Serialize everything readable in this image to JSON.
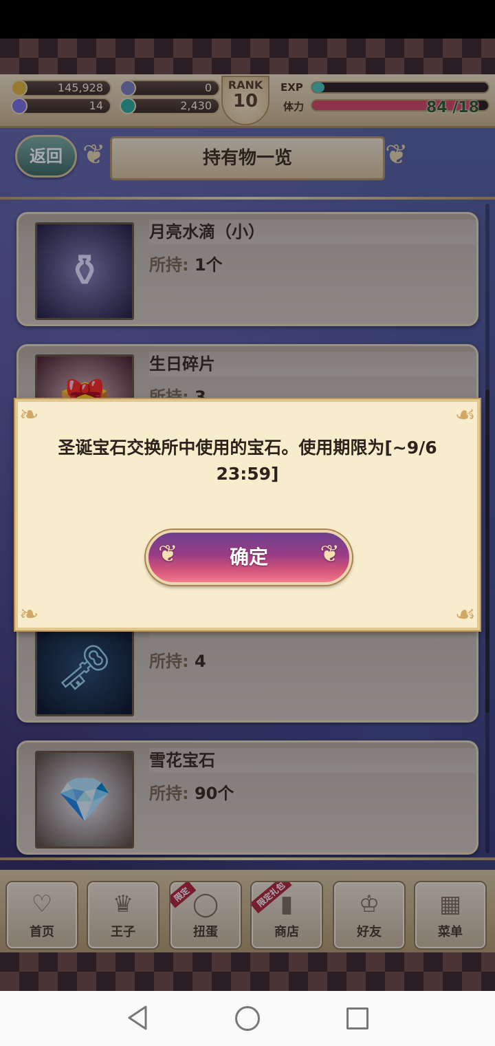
{
  "resources": {
    "gold": "145,928",
    "feather": "0",
    "crystal": "14",
    "gem": "2,430",
    "rank_label": "RANK",
    "rank_value": "10",
    "exp_label": "EXP",
    "exp_fraction": 0.07,
    "stamina_label": "体力",
    "stamina_text": "84 /18",
    "stamina_fraction": 0.95,
    "colors": {
      "gold": "#e2b93a",
      "feather": "#7f7fb8",
      "crystal": "#7c6fe0",
      "gem": "#2fae9b",
      "exp": "#4cc7b8",
      "stamina": "#d64b63"
    }
  },
  "header": {
    "back_label": "返回",
    "title": "持有物一览"
  },
  "items": [
    {
      "name": "月亮水滴（小）",
      "count_label": "所持:",
      "count": "1个",
      "icon": "moon-drop-bottle-icon",
      "glyph": "⚱"
    },
    {
      "name": "生日碎片",
      "count_label": "所持:",
      "count": "3",
      "icon": "birthday-gift-icon",
      "glyph": "🎁"
    },
    {
      "name": "",
      "count_label": "所持:",
      "count": "4",
      "icon": "star-key-icon",
      "glyph": "🗝"
    },
    {
      "name": "雪花宝石",
      "count_label": "所持:",
      "count": "90个",
      "icon": "heart-gem-icon",
      "glyph": "💎"
    }
  ],
  "dialog": {
    "message_line1": "圣诞宝石交换所中使用的宝石。使用期限为[~9/6",
    "message_line2": "23:59]",
    "confirm_label": "确定"
  },
  "nav": [
    {
      "label": "首页",
      "icon": "heart-icon",
      "glyph": "♡",
      "ribbon": ""
    },
    {
      "label": "王子",
      "icon": "crown-icon",
      "glyph": "♛",
      "ribbon": ""
    },
    {
      "label": "扭蛋",
      "icon": "ring-icon",
      "glyph": "◯",
      "ribbon": "限定"
    },
    {
      "label": "商店",
      "icon": "shop-icon",
      "glyph": "▮",
      "ribbon": "限定礼包"
    },
    {
      "label": "好友",
      "icon": "tiara-icon",
      "glyph": "♔",
      "ribbon": ""
    },
    {
      "label": "菜单",
      "icon": "menu-grid-icon",
      "glyph": "▦",
      "ribbon": ""
    }
  ]
}
